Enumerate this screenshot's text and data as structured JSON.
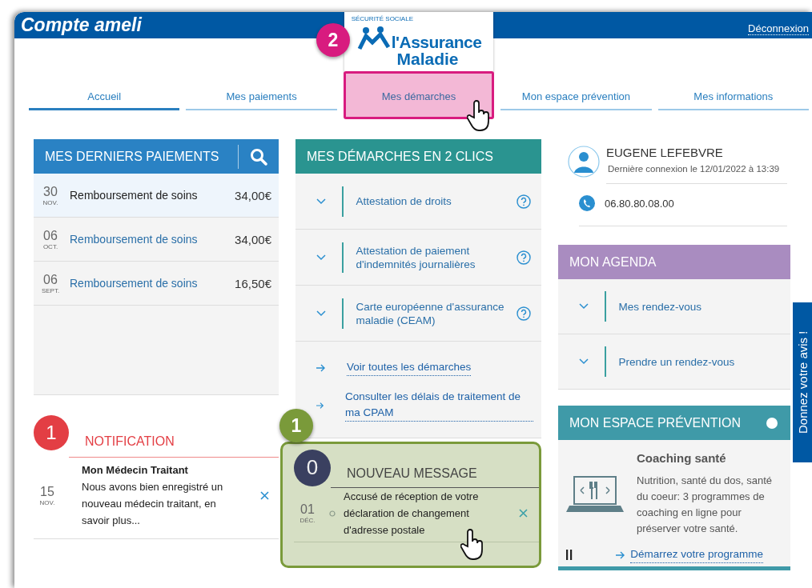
{
  "header": {
    "title": "Compte ameli",
    "logout": "Déconnexion"
  },
  "logo": {
    "arc": "SÉCURITÉ SOCIALE",
    "line1": "l'Assurance",
    "line2": "Maladie"
  },
  "tabs": [
    {
      "label": "Accueil",
      "selected": true
    },
    {
      "label": "Mes paiements",
      "selected": false
    },
    {
      "label": "Mes démarches",
      "selected": false,
      "annotation": {
        "number": "2",
        "color": "#d81b7f"
      }
    },
    {
      "label": "Mon espace prévention",
      "selected": false
    },
    {
      "label": "Mes informations",
      "selected": false
    }
  ],
  "payments": {
    "title": "MES DERNIERS PAIEMENTS",
    "rows": [
      {
        "day": "30",
        "month": "NOV.",
        "label": "Remboursement de soins",
        "amount": "34,00€",
        "selected": true
      },
      {
        "day": "06",
        "month": "OCT.",
        "label": "Remboursement de soins",
        "amount": "34,00€",
        "selected": false
      },
      {
        "day": "06",
        "month": "SEPT.",
        "label": "Remboursement de soins",
        "amount": "16,50€",
        "selected": false
      }
    ]
  },
  "notification": {
    "count": "1",
    "title": "NOTIFICATION",
    "items": [
      {
        "day": "15",
        "month": "NOV.",
        "title": "Mon Médecin Traitant",
        "text": "Nous avons bien enregistré un nouveau médecin traitant, en savoir plus..."
      }
    ]
  },
  "procedures": {
    "title": "MES DÉMARCHES EN 2 CLICS",
    "items": [
      {
        "label": "Attestation de droits"
      },
      {
        "label": "Attestation de paiement d'indemnités journalières"
      },
      {
        "label": "Carte européenne d'assurance maladie (CEAM)"
      }
    ],
    "links": [
      "Voir toutes les démarches",
      "Consulter les délais de traitement de ma CPAM"
    ]
  },
  "message": {
    "count": "0",
    "title": "NOUVEAU MESSAGE",
    "annotation": {
      "number": "1",
      "color": "#7a9a3a"
    },
    "items": [
      {
        "day": "01",
        "month": "DÉC.",
        "text": "Accusé de réception de votre déclaration de changement d'adresse postale"
      }
    ]
  },
  "user": {
    "name": "EUGENE LEFEBVRE",
    "last_login": "Dernière connexion le 12/01/2022 à 13:39",
    "phone": "06.80.80.08.00"
  },
  "agenda": {
    "title": "MON AGENDA",
    "items": [
      "Mes rendez-vous",
      "Prendre un rendez-vous"
    ]
  },
  "prevention": {
    "title": "MON ESPACE PRÉVENTION",
    "card": {
      "title": "Coaching santé",
      "text": "Nutrition, santé du dos, santé du coeur: 3 programmes de coaching en ligne pour préserver votre santé.",
      "link": "Démarrez votre programme"
    }
  },
  "feedback": "Donnez votre avis !"
}
